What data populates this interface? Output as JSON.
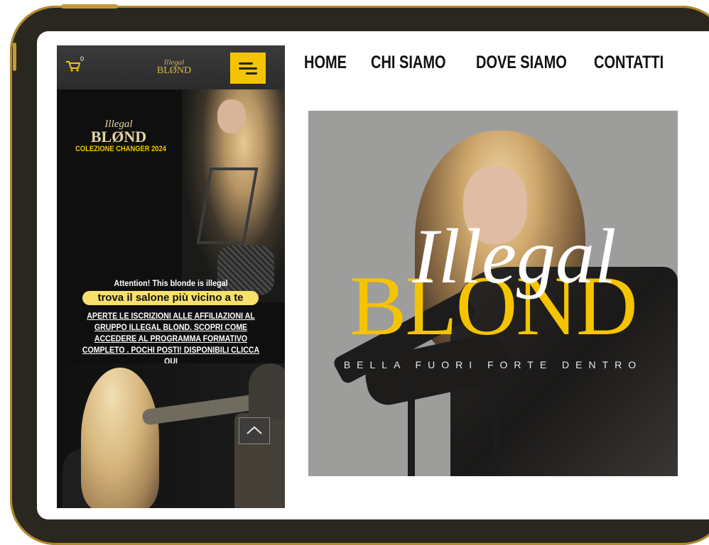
{
  "phone": {
    "cart_count": "0",
    "logo_script": "Illegal",
    "logo_text": "BLØND",
    "collection_logo_script": "Illegal",
    "collection_logo_text": "BLØND",
    "collection_title": "COLEZIONE CHANGER 2024",
    "attention": "Attention! This blonde is illegal",
    "find_salon": "trova il salone più vicino a te",
    "promo": "APERTE LE ISCRIZIONI ALLE AFFILIAZIONI AL GRUPPO ILLEGAL BLOND. SCOPRI COME ACCEDERE AL PROGRAMMA FORMATIVO COMPLETO . POCHI POSTI! DISPONIBILI CLICCA QUI"
  },
  "nav": {
    "home": "HOME",
    "chi_siamo": "CHI SIAMO",
    "dove_siamo": "DOVE SIAMO",
    "contatti": "CONTATTI"
  },
  "hero": {
    "script": "Illegal",
    "brand": "BLOND",
    "tagline": "BELLA FUORI FORTE DENTRO"
  },
  "colors": {
    "accent_yellow": "#f5c400",
    "frame": "#2a2721",
    "frame_gold": "#b48a2a"
  },
  "icons": [
    "cart-icon",
    "hamburger-menu-icon",
    "chevron-up-icon"
  ]
}
